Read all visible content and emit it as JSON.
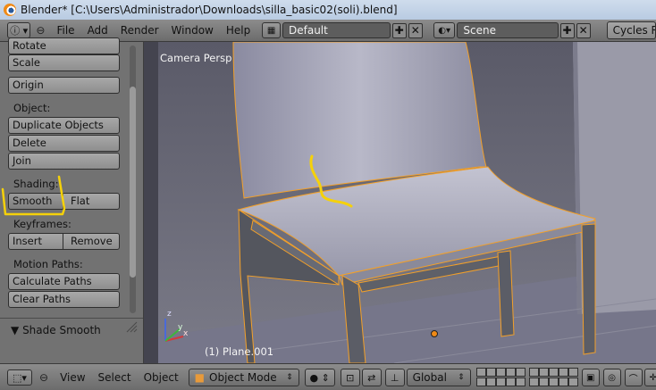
{
  "window": {
    "title": "Blender* [C:\\Users\\Administrador\\Downloads\\silla_basic02(soli).blend]"
  },
  "header": {
    "menus": [
      "File",
      "Add",
      "Render",
      "Window",
      "Help"
    ],
    "screen_layout": "Default",
    "scene": "Scene",
    "render_engine": "Cycles R"
  },
  "toolshelf": {
    "transform_buttons": [
      "Rotate",
      "Scale"
    ],
    "origin_button": "Origin",
    "object_label": "Object:",
    "object_buttons": [
      "Duplicate Objects",
      "Delete",
      "Join"
    ],
    "shading_label": "Shading:",
    "shading_smooth": "Smooth",
    "shading_flat": "Flat",
    "keyframes_label": "Keyframes:",
    "keyframe_insert": "Insert",
    "keyframe_remove": "Remove",
    "motion_paths_label": "Motion Paths:",
    "motion_buttons": [
      "Calculate Paths",
      "Clear Paths"
    ],
    "last_operator_panel": "Shade Smooth"
  },
  "viewport": {
    "view_name": "Camera Persp",
    "object_info": "(1) Plane.001"
  },
  "footer": {
    "menus": [
      "View",
      "Select",
      "Object"
    ],
    "mode": "Object Mode",
    "orientation": "Global"
  },
  "colors": {
    "selection_outline": "#f2a02a",
    "annotation_stroke": "#f5d10a",
    "panel_bg": "#727272"
  }
}
